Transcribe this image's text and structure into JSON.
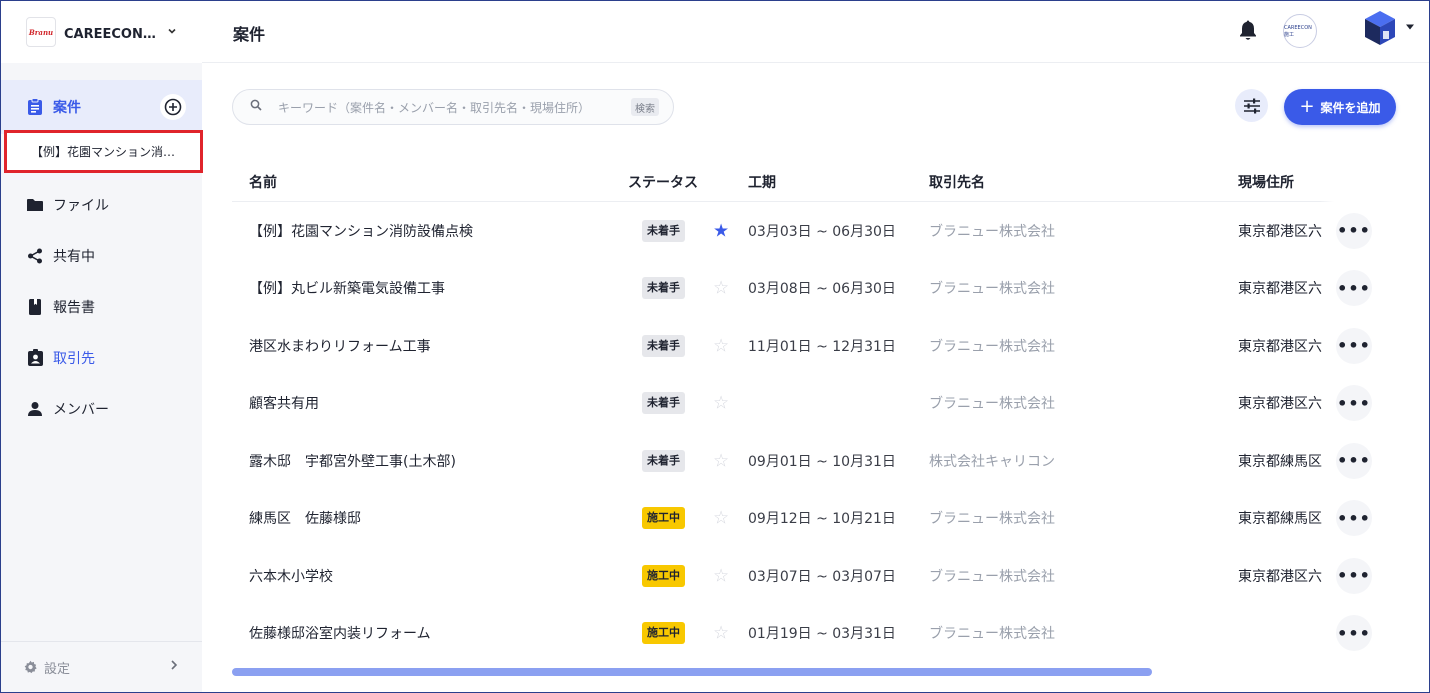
{
  "org": {
    "logo_text": "Branu",
    "name": "CAREECON 施…"
  },
  "sidebar": {
    "items": [
      {
        "label": "案件",
        "icon": "clipboard-icon"
      },
      {
        "label": "ファイル",
        "icon": "folder-icon"
      },
      {
        "label": "共有中",
        "icon": "share-icon"
      },
      {
        "label": "報告書",
        "icon": "book-icon"
      },
      {
        "label": "取引先",
        "icon": "contact-badge-icon"
      },
      {
        "label": "メンバー",
        "icon": "person-icon"
      }
    ],
    "sub_item": "【例】花園マンション消…",
    "settings": "設定"
  },
  "header": {
    "title": "案件",
    "company_avatar_text": "CAREECON施工"
  },
  "search": {
    "placeholder": "キーワード（案件名・メンバー名・取引先名・現場住所）",
    "shortcut": "検索"
  },
  "add_button": "案件を追加",
  "table": {
    "columns": {
      "name": "名前",
      "status": "ステータス",
      "period": "工期",
      "client": "取引先名",
      "address": "現場住所"
    },
    "rows": [
      {
        "name": "【例】花園マンション消防設備点検",
        "status": "未着手",
        "status_type": "todo",
        "starred": true,
        "period": "03月03日 ~ 06月30日",
        "client": "ブラニュー株式会社",
        "address": "東京都港区六"
      },
      {
        "name": "【例】丸ビル新築電気設備工事",
        "status": "未着手",
        "status_type": "todo",
        "starred": false,
        "period": "03月08日 ~ 06月30日",
        "client": "ブラニュー株式会社",
        "address": "東京都港区六"
      },
      {
        "name": "港区水まわりリフォーム工事",
        "status": "未着手",
        "status_type": "todo",
        "starred": false,
        "period": "11月01日 ~ 12月31日",
        "client": "ブラニュー株式会社",
        "address": "東京都港区六"
      },
      {
        "name": "顧客共有用",
        "status": "未着手",
        "status_type": "todo",
        "starred": false,
        "period": "",
        "client": "ブラニュー株式会社",
        "address": "東京都港区六"
      },
      {
        "name": "露木邸　宇都宮外壁工事(土木部)",
        "status": "未着手",
        "status_type": "todo",
        "starred": false,
        "period": "09月01日 ~ 10月31日",
        "client": "株式会社キャリコン",
        "address": "東京都練馬区"
      },
      {
        "name": "練馬区　佐藤様邸",
        "status": "施工中",
        "status_type": "doing",
        "starred": false,
        "period": "09月12日 ~ 10月21日",
        "client": "ブラニュー株式会社",
        "address": "東京都練馬区"
      },
      {
        "name": "六本木小学校",
        "status": "施工中",
        "status_type": "doing",
        "starred": false,
        "period": "03月07日 ~ 03月07日",
        "client": "ブラニュー株式会社",
        "address": "東京都港区六"
      },
      {
        "name": "佐藤様邸浴室内装リフォーム",
        "status": "施工中",
        "status_type": "doing",
        "starred": false,
        "period": "01月19日 ~ 03月31日",
        "client": "ブラニュー株式会社",
        "address": ""
      }
    ]
  },
  "icons": {
    "star_on": "★",
    "star_off": "☆",
    "more": "•••"
  },
  "colors": {
    "accent": "#3a5ae8",
    "in_progress": "#f8c800",
    "highlight_border": "#e0242b"
  }
}
